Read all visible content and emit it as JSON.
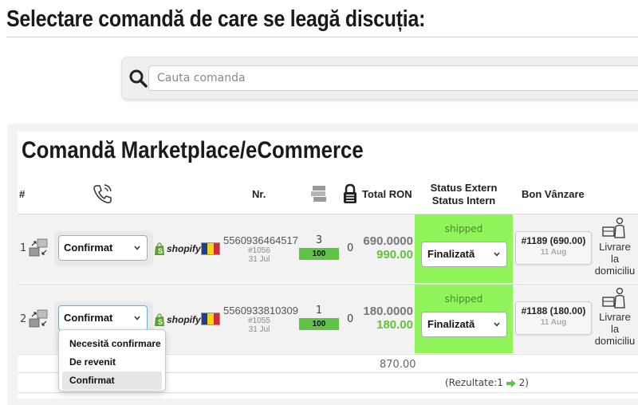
{
  "page_title": "Selectare comandă de care se leagă discuția:",
  "search": {
    "placeholder": "Cauta comanda"
  },
  "panel_title": "Comandă Marketplace/eCommerce",
  "headers": {
    "index": "#",
    "number": "Nr.",
    "total": "Total RON",
    "status_extern": "Status Extern",
    "status_intern": "Status Intern",
    "bon": "Bon Vânzare"
  },
  "rows": [
    {
      "index": "1",
      "confirm_status": "Confirmat",
      "platform": "shopify",
      "order_no": "5560936464517",
      "order_ref": "#1056",
      "order_date": "31 Jul",
      "qty": "3",
      "qty_bar": "100",
      "locked": "0",
      "total_a": "690.0000",
      "total_b": "990.00",
      "status_extern": "shipped",
      "status_intern": "Finalizată",
      "bon_title": "#1189 (690.00)",
      "bon_date": "11 Aug",
      "delivery": [
        "Livrare",
        "la",
        "domiciliu"
      ]
    },
    {
      "index": "2",
      "confirm_status": "Confirmat",
      "platform": "shopify",
      "order_no": "5560933810309",
      "order_ref": "#1055",
      "order_date": "31 Jul",
      "qty": "1",
      "qty_bar": "100",
      "locked": "0",
      "total_a": "180.0000",
      "total_b": "180.00",
      "status_extern": "shipped",
      "status_intern": "Finalizată",
      "bon_title": "#1188 (180.00)",
      "bon_date": "11 Aug",
      "delivery": [
        "Livrare",
        "la",
        "domiciliu"
      ]
    }
  ],
  "sum_total": "870.00",
  "results": {
    "prefix": "(Rezultate:1",
    "suffix": "2)"
  },
  "dropdown_options": [
    "Necesită confirmare",
    "De revenit",
    "Confirmat"
  ],
  "colors": {
    "status_green": "#8ff55a",
    "qty_green": "#5fc445",
    "total_green": "#63c23b",
    "flag_blue": "#1c3f94",
    "flag_yellow": "#f7d117",
    "flag_red": "#ce2b37"
  }
}
